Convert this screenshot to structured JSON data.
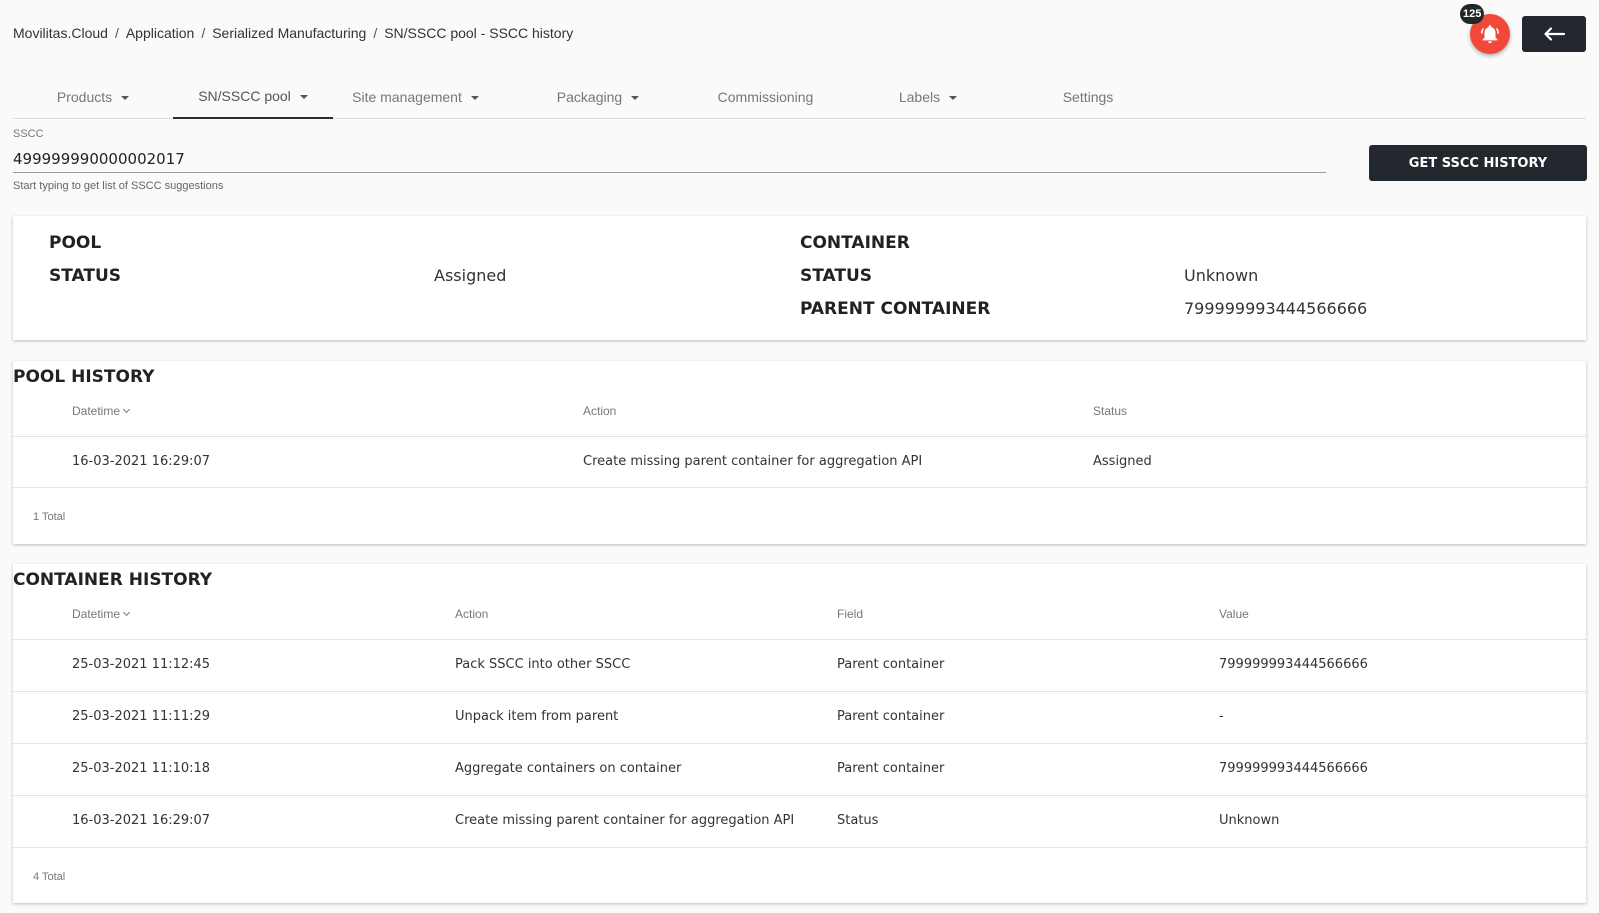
{
  "breadcrumb": [
    "Movilitas.Cloud",
    "Application",
    "Serialized Manufacturing",
    "SN/SSCC pool - SSCC history"
  ],
  "notifications": {
    "count": "125",
    "icon": "bell-icon",
    "color": "#f0493a"
  },
  "header": {
    "back_icon": "arrow-left-icon"
  },
  "tabs": [
    {
      "label": "Products",
      "dropdown": true
    },
    {
      "label": "SN/SSCC pool",
      "dropdown": true,
      "active": true
    },
    {
      "label": "Site management",
      "dropdown": true
    },
    {
      "label": "Packaging",
      "dropdown": true
    },
    {
      "label": "Commissioning",
      "dropdown": false
    },
    {
      "label": "Labels",
      "dropdown": true
    },
    {
      "label": "Settings",
      "dropdown": false
    }
  ],
  "search": {
    "label": "SSCC",
    "value": "499999990000002017",
    "hint": "Start typing to get list of SSCC suggestions",
    "button": "GET SSCC HISTORY"
  },
  "summary": {
    "pool_label": "POOL",
    "pool_status_label": "STATUS",
    "pool_status_value": "Assigned",
    "container_label": "CONTAINER",
    "container_status_label": "STATUS",
    "container_status_value": "Unknown",
    "parent_label": "PARENT CONTAINER",
    "parent_value": "799999993444566666"
  },
  "pool_history": {
    "title": "POOL HISTORY",
    "columns": [
      "Datetime",
      "Action",
      "Status"
    ],
    "rows": [
      [
        "16-03-2021 16:29:07",
        "Create missing parent container for aggregation API",
        "Assigned"
      ]
    ],
    "total": "1 Total"
  },
  "container_history": {
    "title": "CONTAINER HISTORY",
    "columns": [
      "Datetime",
      "Action",
      "Field",
      "Value"
    ],
    "rows": [
      [
        "25-03-2021 11:12:45",
        "Pack SSCC into other SSCC",
        "Parent container",
        "799999993444566666"
      ],
      [
        "25-03-2021 11:11:29",
        "Unpack item from parent",
        "Parent container",
        "-"
      ],
      [
        "25-03-2021 11:10:18",
        "Aggregate containers on container",
        "Parent container",
        "799999993444566666"
      ],
      [
        "16-03-2021 16:29:07",
        "Create missing parent container for aggregation API",
        "Status",
        "Unknown"
      ]
    ],
    "total": "4 Total"
  }
}
